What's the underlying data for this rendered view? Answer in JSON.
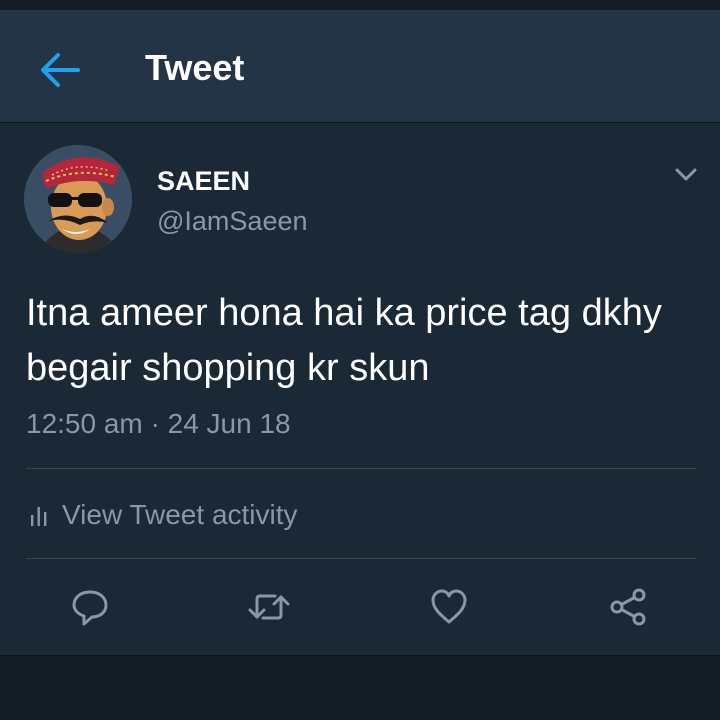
{
  "header": {
    "back_icon": "arrow-left-icon",
    "title": "Tweet"
  },
  "tweet": {
    "display_name": "SAEEN",
    "handle": "@IamSaeen",
    "text": "Itna ameer hona hai ka price tag dkhy begair shopping kr skun",
    "timestamp": "12:50 am · 24 Jun 18",
    "menu_icon": "chevron-down-icon"
  },
  "activity": {
    "icon": "bar-chart-icon",
    "label": "View Tweet activity"
  },
  "actions": [
    {
      "name": "reply",
      "icon": "speech-bubble-icon"
    },
    {
      "name": "retweet",
      "icon": "retweet-icon"
    },
    {
      "name": "like",
      "icon": "heart-icon"
    },
    {
      "name": "share",
      "icon": "share-icon"
    }
  ],
  "colors": {
    "accent": "#1da1f2",
    "header_bg": "#243447",
    "body_bg": "#1b2836",
    "secondary_text": "#8899a6",
    "divider": "#38444d"
  }
}
